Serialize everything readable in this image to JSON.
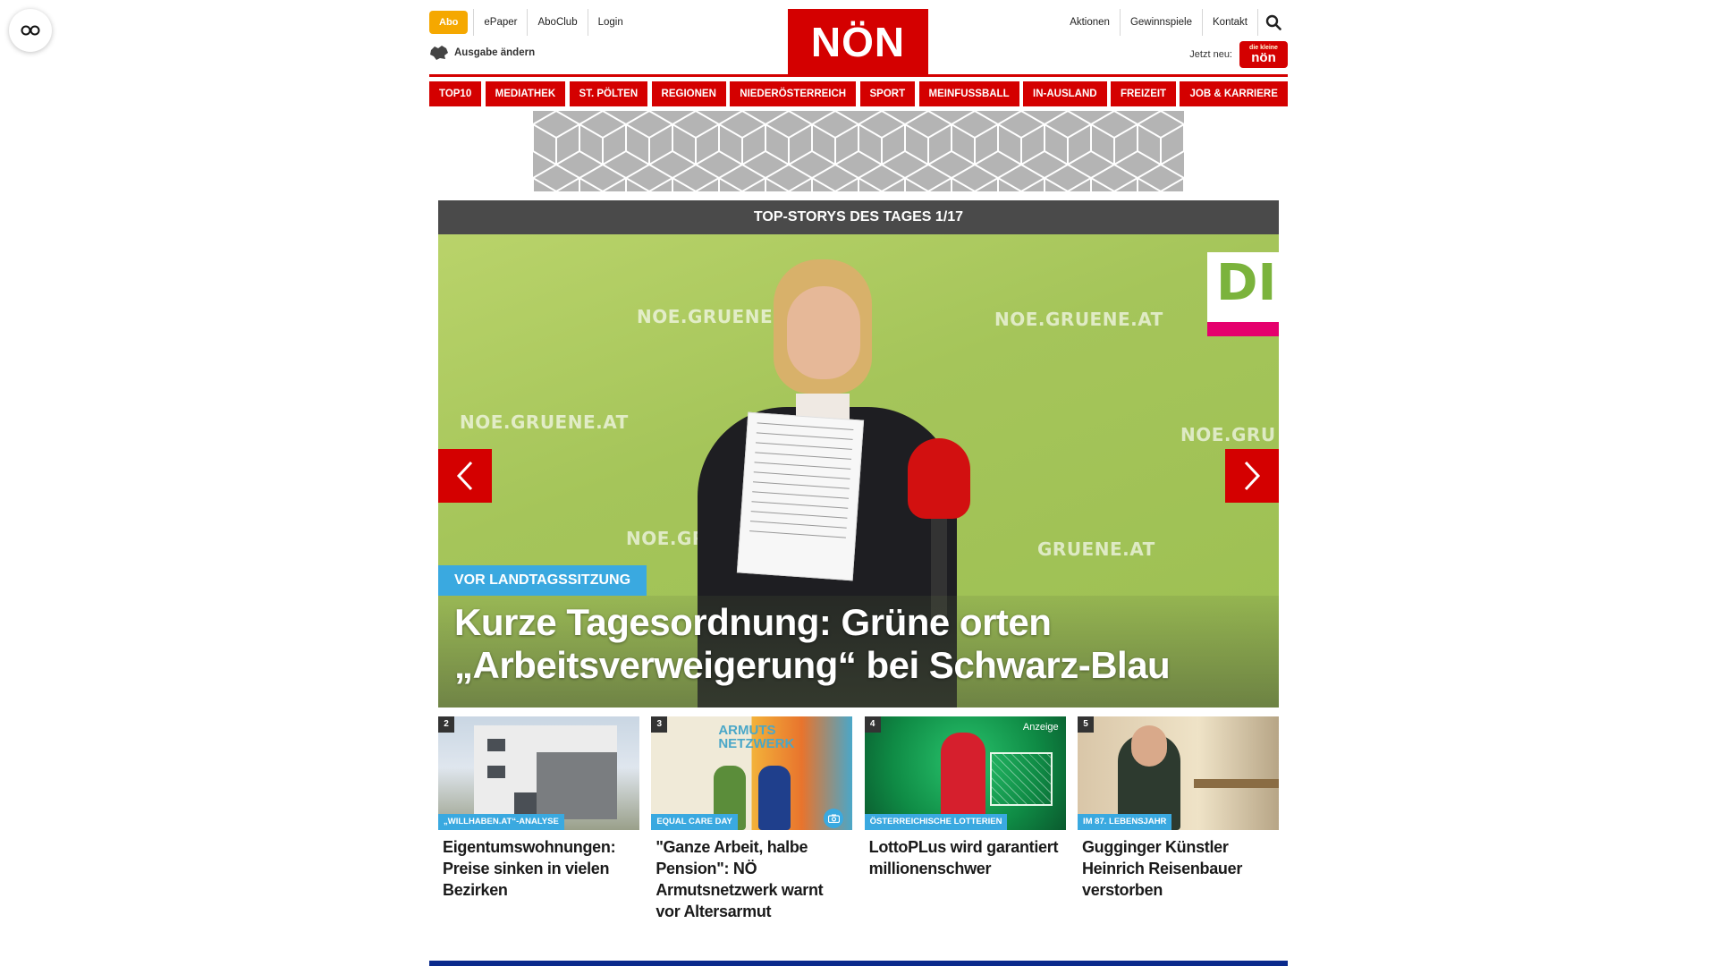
{
  "header": {
    "abo_label": "Abo",
    "left_links": [
      "ePaper",
      "AboClub",
      "Login"
    ],
    "right_links": [
      "Aktionen",
      "Gewinnspiele",
      "Kontakt"
    ],
    "logo_text": "NÖN",
    "edition_label": "Ausgabe ändern",
    "jetzt_neu_label": "Jetzt neu:",
    "kids_logo_line1": "die kleine",
    "kids_logo_line2": "nön"
  },
  "nav": {
    "items": [
      "TOP10",
      "MEDIATHEK",
      "ST. PÖLTEN",
      "REGIONEN",
      "NIEDERÖSTERREICH",
      "SPORT",
      "MEINFUSSBALL",
      "IN-AUSLAND",
      "FREIZEIT",
      "JOB & KARRIERE"
    ]
  },
  "slider": {
    "header": "TOP-STORYS DES TAGES 1/17",
    "watermark": "NOE.GRUENE.AT",
    "watermark_partial_1": "NOE.GR",
    "watermark_partial_2": "GRUENE.AT",
    "watermark_partial_3": "NOE.GRU",
    "corner_text": "DI",
    "kicker": "VOR LANDTAGSSITZUNG",
    "headline": "Kurze Tagesordnung: Grüne orten „Arbeitsverweigerung“ bei Schwarz-Blau"
  },
  "teasers": [
    {
      "num": "2",
      "category": "„WILLHABEN.AT“-ANALYSE",
      "title": "Eigentumswohnungen: Preise sinken in vielen Bezirken"
    },
    {
      "num": "3",
      "category": "EQUAL CARE DAY",
      "title": "\"Ganze Arbeit, halbe Pension\": NÖ Armutsnetzwerk warnt vor Altersarmut",
      "image_text": "ARMUTS NETZWERK"
    },
    {
      "num": "4",
      "category": "ÖSTERREICHISCHE LOTTERIEN",
      "title": "LottoPLus wird garantiert millionenschwer",
      "badge": "Anzeige"
    },
    {
      "num": "5",
      "category": "IM 87. LEBENSJAHR",
      "title": "Gugginger Künstler Heinrich Reisenbauer verstorben"
    }
  ],
  "colors": {
    "brand_red": "#d40000",
    "abo_orange": "#f5a800",
    "kicker_blue": "#3aa9e0",
    "slider_header": "#4a4a4a",
    "footer_blue": "#0a2a8c"
  }
}
